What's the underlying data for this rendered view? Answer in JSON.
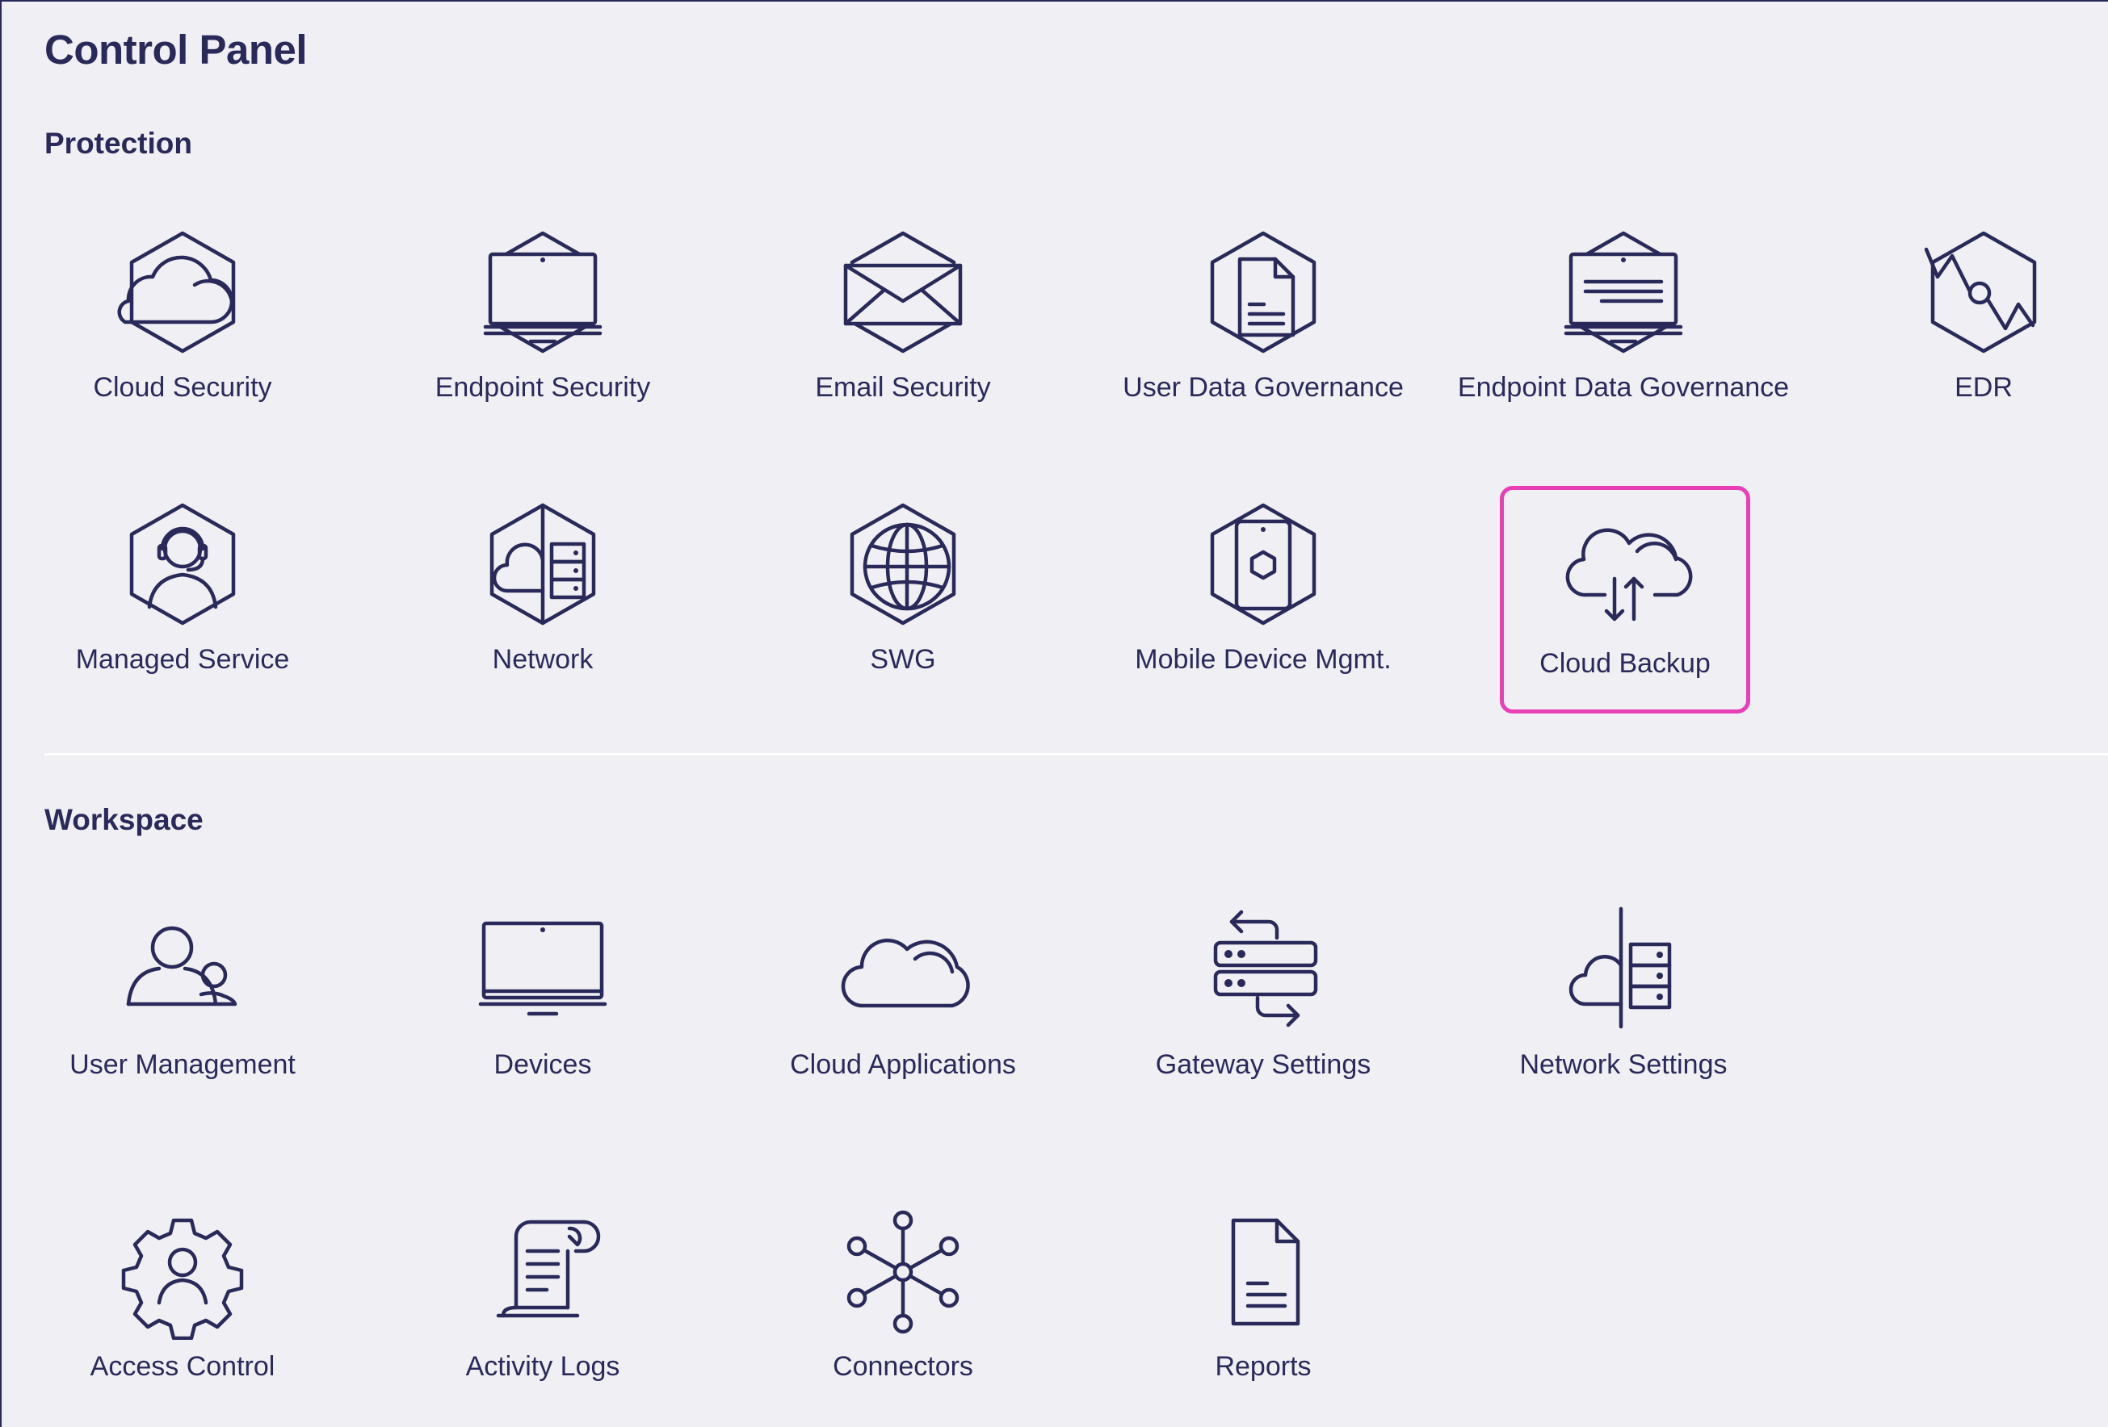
{
  "page": {
    "title": "Control Panel"
  },
  "sections": {
    "protection": {
      "title": "Protection",
      "items": [
        {
          "label": "Cloud Security",
          "icon": "cloud-hex-icon"
        },
        {
          "label": "Endpoint Security",
          "icon": "laptop-hex-icon"
        },
        {
          "label": "Email Security",
          "icon": "envelope-hex-icon"
        },
        {
          "label": "User Data Governance",
          "icon": "document-hex-icon"
        },
        {
          "label": "Endpoint Data Governance",
          "icon": "laptop-document-hex-icon"
        },
        {
          "label": "EDR",
          "icon": "edr-hex-icon"
        },
        {
          "label": "Managed Service",
          "icon": "support-agent-hex-icon"
        },
        {
          "label": "Network",
          "icon": "network-hex-icon"
        },
        {
          "label": "SWG",
          "icon": "globe-hex-icon"
        },
        {
          "label": "Mobile Device Mgmt.",
          "icon": "mobile-hex-icon"
        },
        {
          "label": "Cloud Backup",
          "icon": "cloud-upload-download-icon",
          "selected": true
        }
      ]
    },
    "workspace": {
      "title": "Workspace",
      "items": [
        {
          "label": "User Management",
          "icon": "users-icon"
        },
        {
          "label": "Devices",
          "icon": "monitor-icon"
        },
        {
          "label": "Cloud Applications",
          "icon": "cloud-icon"
        },
        {
          "label": "Gateway Settings",
          "icon": "gateway-servers-icon"
        },
        {
          "label": "Network Settings",
          "icon": "cloud-server-icon"
        },
        {
          "label": "Access Control",
          "icon": "gear-user-icon"
        },
        {
          "label": "Activity Logs",
          "icon": "scroll-log-icon"
        },
        {
          "label": "Connectors",
          "icon": "hub-nodes-icon"
        },
        {
          "label": "Reports",
          "icon": "report-document-icon"
        }
      ]
    }
  },
  "colors": {
    "background": "#f0eff4",
    "text": "#2a2a5a",
    "selected_border": "#e83fb6",
    "divider": "#ffffff"
  }
}
